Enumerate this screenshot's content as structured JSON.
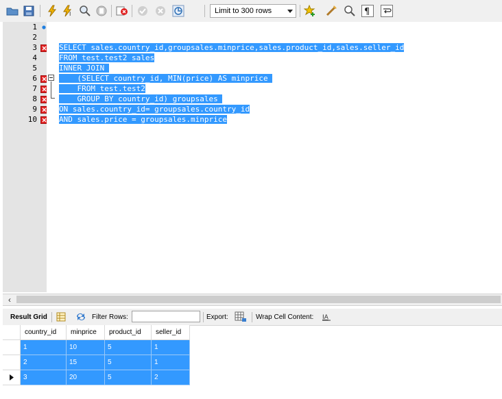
{
  "toolbar": {
    "limit_label": "Limit to 300 rows",
    "icons": [
      "open-folder-icon",
      "save-icon",
      "execute-icon",
      "execute-current-icon",
      "explain-icon",
      "stop-icon",
      "toggle-error-icon",
      "commit-icon",
      "rollback-icon",
      "autocommit-icon",
      "limit-dropdown",
      "add-snippet-icon",
      "beautify-icon",
      "find-icon",
      "invisible-chars-icon",
      "wrap-lines-icon"
    ]
  },
  "editor": {
    "line_numbers": [
      "1",
      "2",
      "3",
      "4",
      "5",
      "6",
      "7",
      "8",
      "9",
      "10"
    ],
    "lines": [
      "",
      "",
      "SELECT sales.country_id,groupsales.minprice,sales.product_id,sales.seller_id",
      "FROM test.test2 sales",
      "INNER JOIN ",
      "    (SELECT country_id, MIN(price) AS minprice ",
      "    FROM test.test2",
      "    GROUP BY country_id) groupsales ",
      "ON sales.country_id= groupsales.country_id",
      "AND sales.price = groupsales.minprice"
    ]
  },
  "result_toolbar": {
    "result_grid_label": "Result Grid",
    "filter_rows_label": "Filter Rows:",
    "filter_value": "",
    "export_label": "Export:",
    "wrap_label": "Wrap Cell Content:"
  },
  "grid": {
    "columns": [
      "country_id",
      "minprice",
      "product_id",
      "seller_id"
    ],
    "rows": [
      [
        "1",
        "10",
        "5",
        "1"
      ],
      [
        "2",
        "15",
        "5",
        "1"
      ],
      [
        "3",
        "20",
        "5",
        "2"
      ]
    ],
    "current_row": 2
  },
  "colors": {
    "selection": "#3399ff",
    "gutter": "#e4e4e4",
    "error_marker": "#e02020",
    "info_marker": "#1f7fe0"
  }
}
